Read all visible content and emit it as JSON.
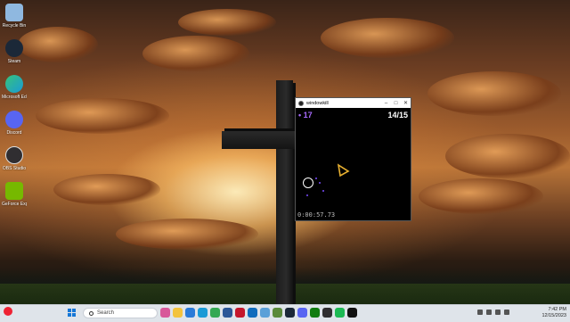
{
  "desktop": {
    "icons": [
      {
        "label": "Recycle Bin",
        "icon": "recycle-bin-icon",
        "color": "#8fb8e0"
      },
      {
        "label": "Steam",
        "icon": "steam-icon",
        "color": "#1b2838"
      },
      {
        "label": "Microsoft Edge",
        "icon": "edge-icon",
        "color": "#1a9ad6"
      },
      {
        "label": "Discord",
        "icon": "discord-icon",
        "color": "#5865f2"
      },
      {
        "label": "OBS Studio",
        "icon": "obs-icon",
        "color": "#302e31"
      },
      {
        "label": "GeForce Experience",
        "icon": "geforce-icon",
        "color": "#76b900"
      }
    ]
  },
  "game_window": {
    "title": "windowkill",
    "xp": "• 17",
    "enemy_count": "14/15",
    "timer": "0:00:57.73",
    "colors": {
      "xp": "#a86bff",
      "enemy": "#e8b030",
      "player": "#ffffff"
    }
  },
  "taskbar": {
    "search_placeholder": "Search",
    "clock_time": "7:42 PM",
    "clock_date": "12/15/2023",
    "apps": [
      {
        "icon": "photos-icon",
        "color": "#d8589a"
      },
      {
        "icon": "file-explorer-icon",
        "color": "#f3c33c"
      },
      {
        "icon": "store-icon",
        "color": "#2a7bd8"
      },
      {
        "icon": "edge-icon",
        "color": "#1a9ad6"
      },
      {
        "icon": "chrome-icon",
        "color": "#34a853"
      },
      {
        "icon": "word-icon",
        "color": "#2b5797"
      },
      {
        "icon": "mcafee-icon",
        "color": "#c4172c"
      },
      {
        "icon": "outlook-icon",
        "color": "#0f6cbd"
      },
      {
        "icon": "photos-app-icon",
        "color": "#5aa0d8"
      },
      {
        "icon": "minecraft-icon",
        "color": "#5a8a3a"
      },
      {
        "icon": "steam-icon",
        "color": "#1b2838"
      },
      {
        "icon": "discord-icon",
        "color": "#5865f2"
      },
      {
        "icon": "xbox-icon",
        "color": "#107c10"
      },
      {
        "icon": "obs-icon",
        "color": "#302e31"
      },
      {
        "icon": "spotify-icon",
        "color": "#1db954"
      },
      {
        "icon": "windowkill-icon",
        "color": "#111111"
      }
    ]
  }
}
